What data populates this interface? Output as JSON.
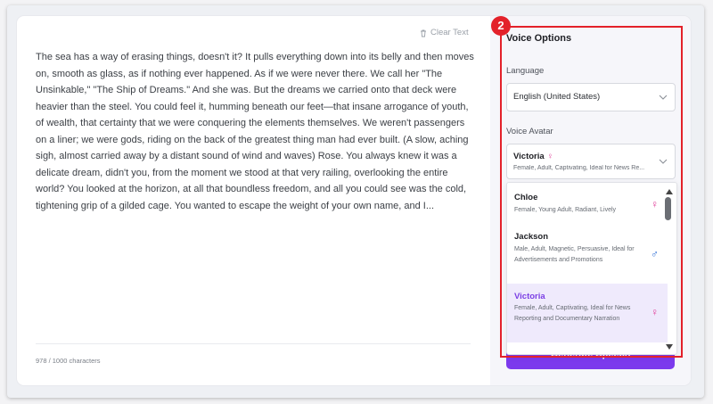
{
  "editor": {
    "clear_label": "Clear Text",
    "text": "The sea has a way of erasing things, doesn't it? It pulls everything down into its belly and then moves on, smooth as glass, as if nothing ever happened. As if we were never there. We call her \"The Unsinkable,\" \"The Ship of Dreams.\" And she was. But the dreams we carried onto that deck were heavier than the steel. You could feel it, humming beneath our feet—that insane arrogance of youth, of wealth, that certainty that we were conquering the elements themselves. We weren't passengers on a liner; we were gods, riding on the back of the greatest thing man had ever built. (A slow, aching sigh, almost carried away by a distant sound of wind and waves) Rose. You always knew it was a delicate dream, didn't you, from the moment we stood at that very railing, overlooking the entire world? You looked at the horizon, at all that boundless freedom, and all you could see was the cold, tightening grip of a gilded cage. You wanted to escape the weight of your own name, and I...",
    "char_count": "978 / 1000 characters"
  },
  "voice_options": {
    "title": "Voice Options",
    "language_label": "Language",
    "language_value": "English (United States)",
    "avatar_label": "Voice Avatar",
    "selected": {
      "name": "Victoria",
      "gender_icon": "♀",
      "desc": "Female, Adult, Captivating, Ideal for News Re..."
    },
    "options": [
      {
        "name": "Chloe",
        "desc": "Female, Young Adult, Radiant, Lively",
        "gender_icon": "♀",
        "gender_color": "#e0419a"
      },
      {
        "name": "Jackson",
        "desc": "Male, Adult, Magnetic, Persuasive, Ideal for Advertisements and Promotions",
        "gender_icon": "♂",
        "gender_color": "#2f6fd6"
      },
      {
        "name": "Victoria",
        "desc": "Female, Adult, Captivating, Ideal for News Reporting and Documentary Narration",
        "gender_icon": "♀",
        "gender_color": "#e0419a"
      }
    ],
    "generate_label": "Generate Speech"
  },
  "annotation": {
    "badge_number": "2",
    "highlight_color": "#e3212a"
  },
  "colors": {
    "accent": "#7c3aed"
  }
}
